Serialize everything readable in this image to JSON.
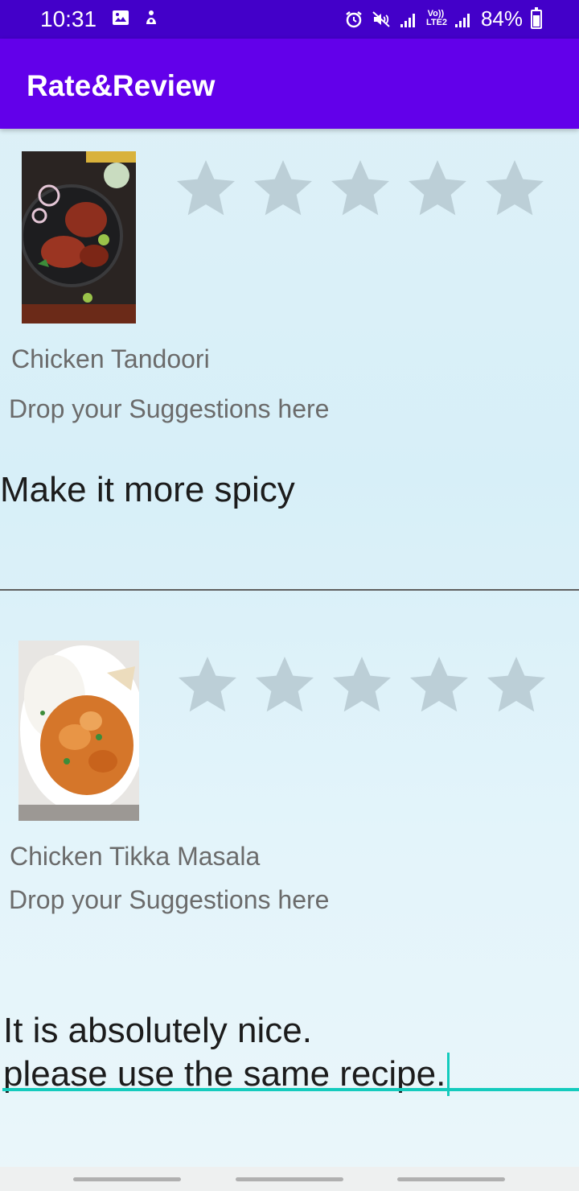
{
  "status_bar": {
    "time": "10:31",
    "battery_percent": "84%",
    "left_icons": [
      "gallery-icon",
      "notification-app-icon"
    ],
    "right_icons": [
      "alarm-icon",
      "mute-icon",
      "signal-icon",
      "volte-lte2-icon",
      "signal-icon",
      "battery-icon"
    ],
    "volte_top": "Vo))",
    "volte_bottom": "LTE2"
  },
  "app_bar": {
    "title": "Rate&Review"
  },
  "reviews": [
    {
      "dish_name": "Chicken Tandoori",
      "rating": 0,
      "max_rating": 5,
      "suggestions_label": "Drop your Suggestions here",
      "review_text": "Make it more spicy",
      "image": "chicken-tandoori-photo"
    },
    {
      "dish_name": "Chicken Tikka Masala",
      "rating": 0,
      "max_rating": 5,
      "suggestions_label": "Drop your Suggestions here",
      "review_text": "It is absolutely nice.\nplease use the same recipe.",
      "image": "chicken-tikka-masala-photo"
    }
  ],
  "colors": {
    "status_bar": "#4300c9",
    "app_bar": "#6200ea",
    "star_empty": "#bccfd7",
    "accent_underline": "#14cbbd"
  }
}
